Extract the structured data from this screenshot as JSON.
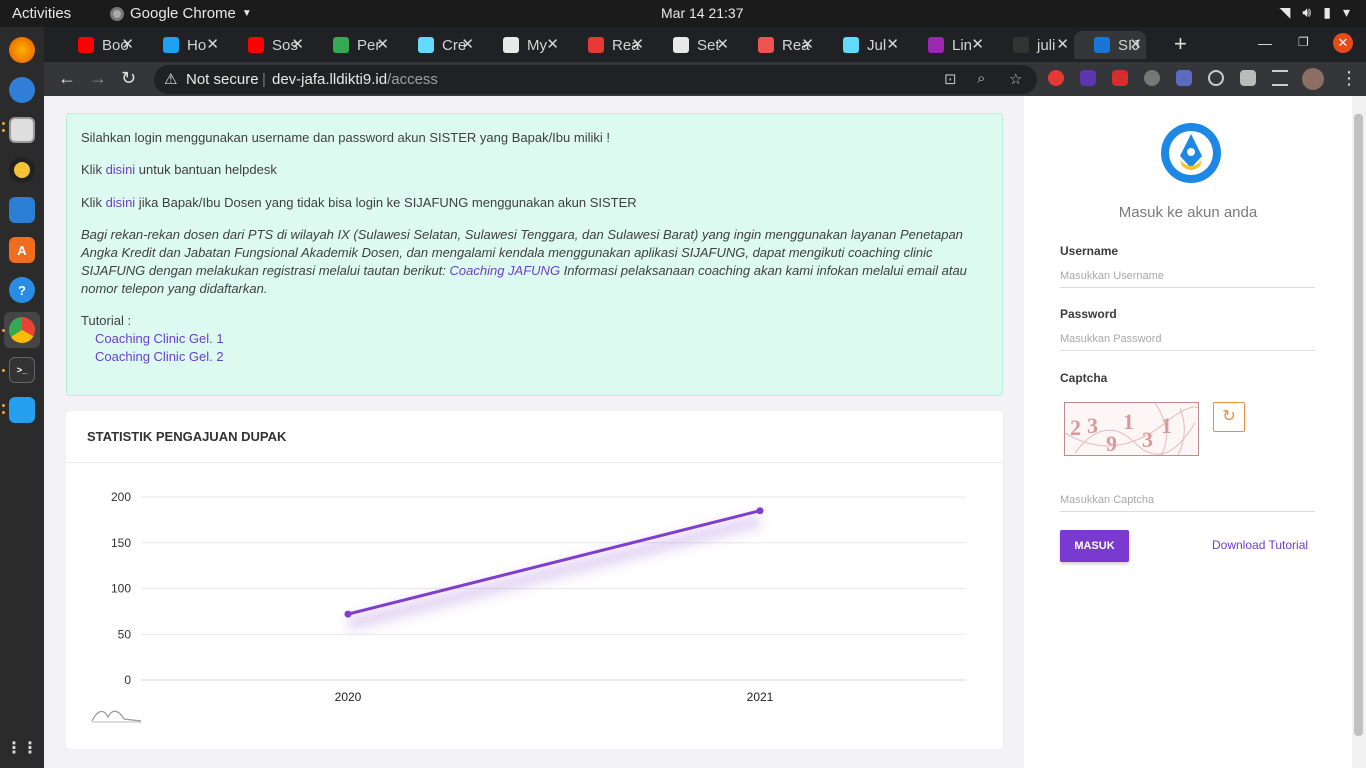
{
  "desktop": {
    "activities": "Activities",
    "app_name": "Google Chrome",
    "clock": "Mar 14  21:37"
  },
  "dock": {
    "items": [
      "firefox",
      "thunderbird",
      "files",
      "rhythmbox",
      "writer",
      "software",
      "help",
      "chrome",
      "terminal",
      "vscode",
      "apps-grid"
    ]
  },
  "browser": {
    "tabs": [
      {
        "label": "Boo",
        "favicon_color": "#ff0000"
      },
      {
        "label": "Ho",
        "favicon_color": "#1da1f2"
      },
      {
        "label": "Sos",
        "favicon_color": "#ff0000"
      },
      {
        "label": "Per",
        "favicon_color": "#34a853"
      },
      {
        "label": "Cre",
        "favicon_color": "#61dafb"
      },
      {
        "label": "My",
        "favicon_color": "#e8e8e8"
      },
      {
        "label": "Rea",
        "favicon_color": "#e53935"
      },
      {
        "label": "Set",
        "favicon_color": "#e8e8e8"
      },
      {
        "label": "Rea",
        "favicon_color": "#ef5350"
      },
      {
        "label": "Jul",
        "favicon_color": "#61dafb"
      },
      {
        "label": "Lin",
        "favicon_color": "#9c27b0"
      },
      {
        "label": "juli",
        "favicon_color": "#333333"
      },
      {
        "label": "SIJ",
        "favicon_color": "#1976d2"
      }
    ],
    "security_label": "Not secure",
    "url_host": "dev-jafa.lldikti9.id",
    "url_path": "/access"
  },
  "notice": {
    "line1": "Silahkan login menggunakan username dan password akun SISTER yang Bapak/Ibu miliki !",
    "line2_prefix": "Klik ",
    "line2_link": "disini",
    "line2_suffix": " untuk bantuan helpdesk",
    "line3_prefix": "Klik ",
    "line3_link": "disini",
    "line3_suffix": " jika Bapak/Ibu Dosen yang tidak bisa login ke SIJAFUNG menggunakan akun SISTER",
    "paragraph_prefix": "Bagi rekan-rekan dosen dari PTS di wilayah IX (Sulawesi Selatan, Sulawesi Tenggara, dan Sulawesi Barat) yang ingin menggunakan layanan Penetapan Angka Kredit dan Jabatan Fungsional Akademik Dosen, dan mengalami kendala menggunakan aplikasi SIJAFUNG, dapat mengikuti coaching clinic SIJAFUNG dengan melakukan registrasi melalui tautan berikut: ",
    "paragraph_link": "Coaching JAFUNG",
    "paragraph_suffix": " Informasi pelaksanaan coaching akan kami infokan melalui email atau nomor telepon yang didaftarkan.",
    "tutorial_label": "Tutorial :",
    "tutorial_links": [
      "Coaching Clinic Gel. 1",
      "Coaching Clinic Gel. 2"
    ]
  },
  "stats": {
    "title": "STATISTIK PENGAJUAN DUPAK"
  },
  "chart_data": {
    "type": "line",
    "categories": [
      "2020",
      "2021"
    ],
    "series": [
      {
        "values": [
          72,
          185
        ]
      }
    ],
    "yticks": [
      200,
      150,
      100,
      50,
      0
    ],
    "ylim": [
      0,
      200
    ],
    "grid": true,
    "color": "#7e3fd0"
  },
  "login": {
    "heading": "Masuk ke akun anda",
    "username_label": "Username",
    "username_placeholder": "Masukkan Username",
    "password_label": "Password",
    "password_placeholder": "Masukkan Password",
    "captcha_label": "Captcha",
    "captcha_chars": [
      "2",
      "3",
      "9",
      "1",
      "3",
      "1"
    ],
    "captcha_placeholder": "Masukkan Captcha",
    "submit_label": "MASUK",
    "download_label": "Download Tutorial"
  }
}
